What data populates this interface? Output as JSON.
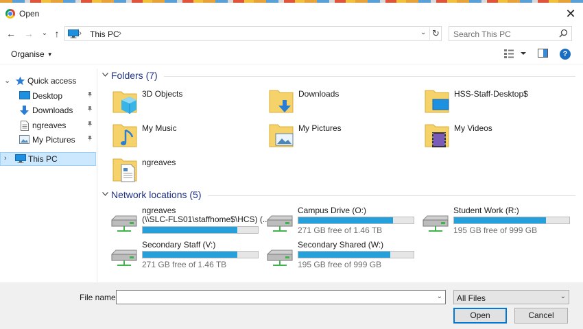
{
  "window": {
    "title": "Open",
    "close_glyph": "✕"
  },
  "nav": {
    "back_glyph": "←",
    "forward_glyph": "→",
    "recent_glyph": "⌄",
    "up_glyph": "↑",
    "address": {
      "crumb": "This PC",
      "sep_before": "›",
      "sep_after": "›",
      "dropdown_glyph": "⌄",
      "refresh_glyph": "↻"
    },
    "search_placeholder": "Search This PC"
  },
  "toolbar": {
    "organise_label": "Organise",
    "organise_arrow": "▼",
    "help_glyph": "?"
  },
  "sidebar": {
    "quick_access": {
      "label": "Quick access",
      "chevron": "⌄",
      "icon": "star-icon"
    },
    "items": [
      {
        "label": "Desktop",
        "icon": "desktop-icon",
        "pin": "📌"
      },
      {
        "label": "Downloads",
        "icon": "downloads-icon",
        "pin": "📌"
      },
      {
        "label": "ngreaves",
        "icon": "document-icon",
        "pin": "📌"
      },
      {
        "label": "My Pictures",
        "icon": "pictures-icon",
        "pin": "📌"
      }
    ],
    "this_pc": {
      "label": "This PC",
      "chevron": "›",
      "icon": "pc-icon"
    }
  },
  "folders_group": {
    "title": "Folders (7)",
    "items": [
      {
        "label": "3D Objects",
        "icon": "3d-objects-folder-icon"
      },
      {
        "label": "Downloads",
        "icon": "downloads-folder-icon"
      },
      {
        "label": "HSS-Staff-Desktop$",
        "icon": "desktop-folder-icon"
      },
      {
        "label": "My Music",
        "icon": "music-folder-icon"
      },
      {
        "label": "My Pictures",
        "icon": "pictures-folder-icon"
      },
      {
        "label": "My Videos",
        "icon": "videos-folder-icon"
      },
      {
        "label": "ngreaves",
        "icon": "document-folder-icon"
      }
    ]
  },
  "network_group": {
    "title": "Network locations (5)",
    "drives": [
      {
        "name_line1": "ngreaves",
        "name_line2": "(\\\\SLC-FLS01\\staffhome$\\HCS) (...",
        "free": "",
        "used_fraction": 0.82
      },
      {
        "name_line1": "Campus Drive (O:)",
        "name_line2": "",
        "free": "271 GB free of 1.46 TB",
        "used_fraction": 0.82
      },
      {
        "name_line1": "Student Work (R:)",
        "name_line2": "",
        "free": "195 GB free of 999 GB",
        "used_fraction": 0.8
      },
      {
        "name_line1": "Secondary Staff (V:)",
        "name_line2": "",
        "free": "271 GB free of 1.46 TB",
        "used_fraction": 0.82
      },
      {
        "name_line1": "Secondary Shared (W:)",
        "name_line2": "",
        "free": "195 GB free of 999 GB",
        "used_fraction": 0.8
      }
    ]
  },
  "footer": {
    "file_name_label": "File name:",
    "file_name_value": "",
    "file_type": "All Files",
    "dropdown_glyph": "⌄",
    "open_label": "Open",
    "cancel_label": "Cancel"
  },
  "colors": {
    "accent": "#0078d7",
    "group_title": "#1e3287",
    "bar_fill": "#26a0da",
    "selection": "#cce8ff"
  }
}
